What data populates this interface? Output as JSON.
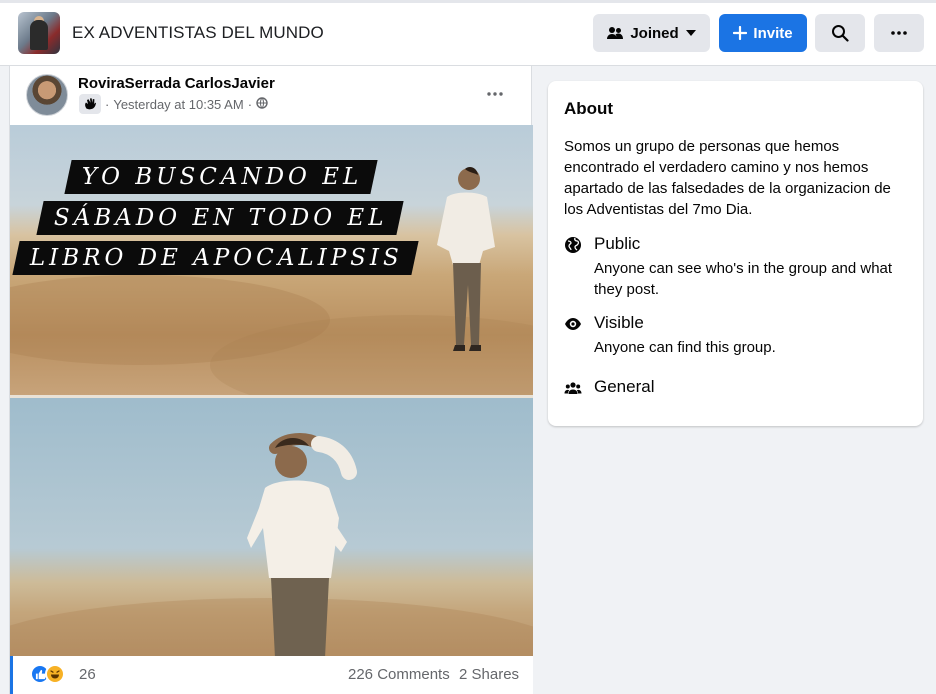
{
  "header": {
    "group_name": "EX ADVENTISTAS DEL MUNDO",
    "joined_label": "Joined",
    "invite_label": "Invite"
  },
  "post": {
    "author": "RoviraSerrada CarlosJavier",
    "timestamp": "Yesterday at 10:35 AM",
    "meme_lines": [
      "YO BUSCANDO EL",
      "SÁBADO EN TODO EL",
      "LIBRO DE APOCALIPSIS"
    ],
    "reaction_count": "26",
    "comments": "226 Comments",
    "shares": "2 Shares"
  },
  "about": {
    "title": "About",
    "description": "Somos un grupo de personas que hemos encontrado el verdadero camino y nos hemos apartado de las falsedades de la organizacion de los Adventistas del 7mo Dia.",
    "privacy": {
      "label": "Public",
      "detail": "Anyone can see who's in the group and what they post."
    },
    "visibility": {
      "label": "Visible",
      "detail": "Anyone can find this group."
    },
    "type": {
      "label": "General"
    }
  },
  "colors": {
    "accent": "#1b74e4",
    "page_bg": "#f0f2f5",
    "secondary_text": "#65676b"
  },
  "icons": [
    "people-icon",
    "caret-down-icon",
    "plus-icon",
    "search-icon",
    "more-icon",
    "globe-icon",
    "eye-icon",
    "group-icon",
    "like-reaction-icon",
    "haha-reaction-icon",
    "wave-badge-icon"
  ]
}
